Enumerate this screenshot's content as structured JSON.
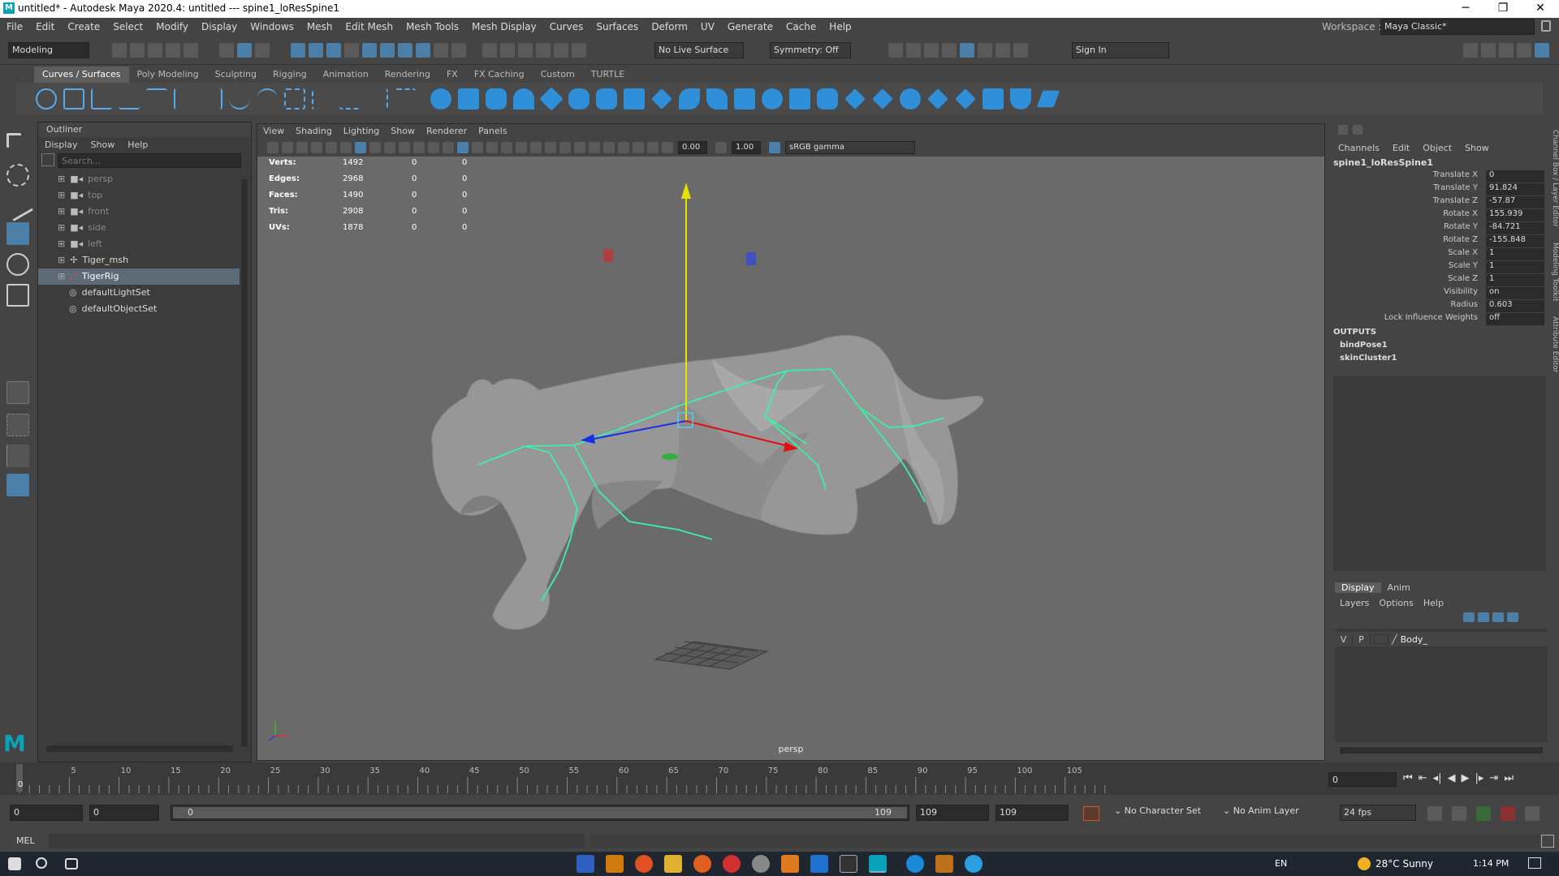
{
  "window": {
    "title": "untitled* - Autodesk Maya 2020.4: untitled   ---   spine1_loResSpine1",
    "logo": "M",
    "controls": [
      "─",
      "❐",
      "✕"
    ]
  },
  "menubar": [
    "File",
    "Edit",
    "Create",
    "Select",
    "Modify",
    "Display",
    "Windows",
    "Mesh",
    "Edit Mesh",
    "Mesh Tools",
    "Mesh Display",
    "Curves",
    "Surfaces",
    "Deform",
    "UV",
    "Generate",
    "Cache",
    "Help"
  ],
  "workspace": {
    "label": "Workspace :",
    "value": "Maya Classic*"
  },
  "statusline": {
    "mode": "Modeling",
    "live_surface": "No Live Surface",
    "symmetry": "Symmetry: Off",
    "sign_in": "Sign In"
  },
  "shelf_tabs": [
    "Curves / Surfaces",
    "Poly Modeling",
    "Sculpting",
    "Rigging",
    "Animation",
    "Rendering",
    "FX",
    "FX Caching",
    "Custom",
    "TURTLE"
  ],
  "shelf_active": "Curves / Surfaces",
  "outliner": {
    "title": "Outliner",
    "menu": [
      "Display",
      "Show",
      "Help"
    ],
    "search_placeholder": "Search...",
    "items": [
      {
        "label": "persp",
        "dim": true,
        "icon": "camera-icon"
      },
      {
        "label": "top",
        "dim": true,
        "icon": "camera-icon"
      },
      {
        "label": "front",
        "dim": true,
        "icon": "camera-icon"
      },
      {
        "label": "side",
        "dim": true,
        "icon": "camera-icon"
      },
      {
        "label": "left",
        "dim": true,
        "icon": "camera-icon"
      },
      {
        "label": "Tiger_msh",
        "dim": false,
        "icon": "mesh-icon"
      },
      {
        "label": "TigerRig",
        "dim": false,
        "icon": "joint-icon",
        "selected": true
      },
      {
        "label": "defaultLightSet",
        "dim": false,
        "icon": "set-icon"
      },
      {
        "label": "defaultObjectSet",
        "dim": false,
        "icon": "set-icon"
      }
    ]
  },
  "viewport": {
    "menu": [
      "View",
      "Shading",
      "Lighting",
      "Show",
      "Renderer",
      "Panels"
    ],
    "exposure": "0.00",
    "gamma": "1.00",
    "color_space": "sRGB gamma",
    "camera_label": "persp",
    "hud": [
      {
        "label": "Verts:",
        "v1": "1492",
        "v2": "0",
        "v3": "0"
      },
      {
        "label": "Edges:",
        "v1": "2968",
        "v2": "0",
        "v3": "0"
      },
      {
        "label": "Faces:",
        "v1": "1490",
        "v2": "0",
        "v3": "0"
      },
      {
        "label": "Tris:",
        "v1": "2908",
        "v2": "0",
        "v3": "0"
      },
      {
        "label": "UVs:",
        "v1": "1878",
        "v2": "0",
        "v3": "0"
      }
    ]
  },
  "channel_box": {
    "menu": [
      "Channels",
      "Edit",
      "Object",
      "Show"
    ],
    "node": "spine1_loResSpine1",
    "attrs": [
      {
        "label": "Translate X",
        "value": "0"
      },
      {
        "label": "Translate Y",
        "value": "91.824"
      },
      {
        "label": "Translate Z",
        "value": "-57.87"
      },
      {
        "label": "Rotate X",
        "value": "155.939"
      },
      {
        "label": "Rotate Y",
        "value": "-84.721"
      },
      {
        "label": "Rotate Z",
        "value": "-155.848"
      },
      {
        "label": "Scale X",
        "value": "1"
      },
      {
        "label": "Scale Y",
        "value": "1"
      },
      {
        "label": "Scale Z",
        "value": "1"
      },
      {
        "label": "Visibility",
        "value": "on"
      },
      {
        "label": "Radius",
        "value": "0.603"
      },
      {
        "label": "Lock Influence Weights",
        "value": "off"
      }
    ],
    "outputs_label": "OUTPUTS",
    "outputs": [
      "bindPose1",
      "skinCluster1"
    ],
    "side_tabs": [
      "Channel Box / Layer Editor",
      "Modeling Toolkit",
      "Attribute Editor"
    ]
  },
  "layer_editor": {
    "tabs": [
      "Display",
      "Anim"
    ],
    "menu": [
      "Layers",
      "Options",
      "Help"
    ],
    "layer": {
      "v": "V",
      "p": "P",
      "name": "Body_"
    }
  },
  "timeline": {
    "ticks": [
      "0",
      "5",
      "10",
      "15",
      "20",
      "25",
      "30",
      "35",
      "40",
      "45",
      "50",
      "55",
      "60",
      "65",
      "70",
      "75",
      "80",
      "85",
      "90",
      "95",
      "100",
      "105"
    ],
    "current_frame": "0",
    "frame_field": "0"
  },
  "range": {
    "start": "0",
    "range_start": "0",
    "slider_start": "0",
    "slider_end": "109",
    "range_end": "109",
    "end": "109",
    "character_set": "No Character Set",
    "anim_layer": "No Anim Layer",
    "fps": "24 fps"
  },
  "cmdline": {
    "label": "MEL"
  },
  "taskbar": {
    "lang": "EN",
    "weather": "28°C  Sunny",
    "time": "1:14 PM"
  },
  "colors": {
    "accent": "#4b7fa8",
    "joint": "#3cf0a8",
    "mesh": "#9a9a9a",
    "viewport_bg": "#6a6a6a",
    "manip_x": "#e01010",
    "manip_y": "#e8e000",
    "manip_z": "#1a2fe8"
  }
}
